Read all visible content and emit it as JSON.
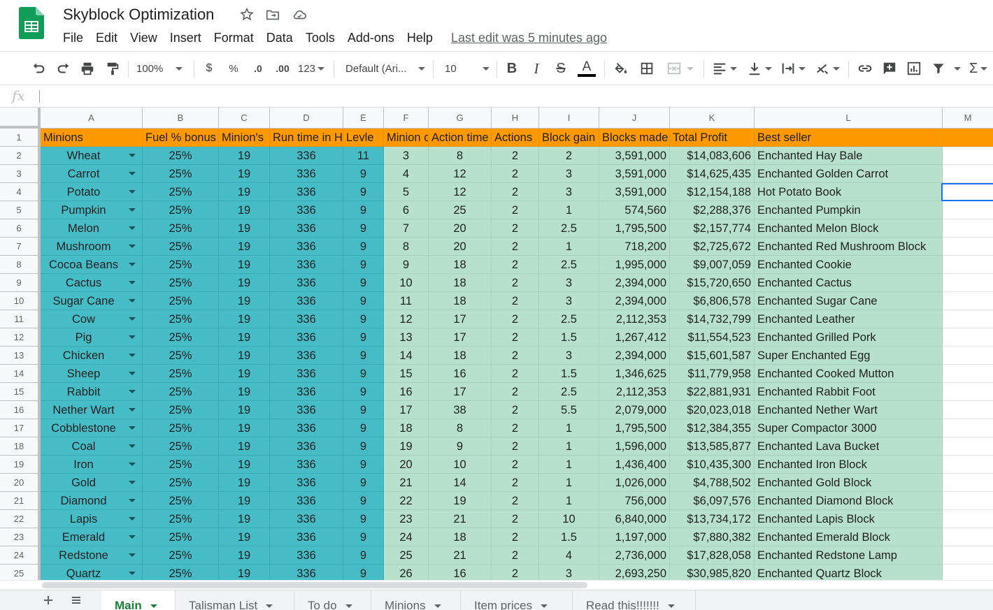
{
  "doc": {
    "title": "Skyblock Optimization",
    "last_edit": "Last edit was 5 minutes ago"
  },
  "menu": [
    "File",
    "Edit",
    "View",
    "Insert",
    "Format",
    "Data",
    "Tools",
    "Add-ons",
    "Help"
  ],
  "toolbar": {
    "zoom": "100%",
    "currency": "$",
    "percent": "%",
    "decrease_decimal": ".0",
    "increase_decimal": ".00",
    "more_formats": "123",
    "font": "Default (Ari...",
    "font_size": "10",
    "bold": "B",
    "italic": "I",
    "strikethrough": "S",
    "text_color": "A"
  },
  "formula_bar": {
    "icon": "fx",
    "value": ""
  },
  "colors": {
    "header_orange": "#ff9900",
    "teal": "#46bdc6",
    "mint": "#b7e1cd",
    "selection": "#1a73e8",
    "active_tab": "#188038"
  },
  "grid": {
    "columns": [
      "A",
      "B",
      "C",
      "D",
      "E",
      "F",
      "G",
      "H",
      "I",
      "J",
      "K",
      "L",
      "M"
    ],
    "header_row": [
      "Minions",
      "Fuel % bonus",
      "Minion's",
      "Run time in H",
      "Levle",
      "Minion c",
      "Action time",
      "Actions",
      "Block gain",
      "Blocks made",
      "Total Profit",
      "Best seller"
    ],
    "row_numbers": [
      "1",
      "2",
      "3",
      "4",
      "5",
      "6",
      "7",
      "8",
      "9",
      "10",
      "11",
      "12",
      "13",
      "14",
      "15",
      "16",
      "17",
      "18",
      "19",
      "20",
      "21",
      "22",
      "23",
      "24",
      "25"
    ],
    "selected_cell": "M4",
    "rows": [
      [
        "Wheat",
        "25%",
        "19",
        "336",
        "11",
        "3",
        "8",
        "2",
        "2",
        "3,591,000",
        "$14,083,606",
        "Enchanted Hay Bale"
      ],
      [
        "Carrot",
        "25%",
        "19",
        "336",
        "9",
        "4",
        "12",
        "2",
        "3",
        "3,591,000",
        "$14,625,435",
        "Enchanted Golden Carrot"
      ],
      [
        "Potato",
        "25%",
        "19",
        "336",
        "9",
        "5",
        "12",
        "2",
        "3",
        "3,591,000",
        "$12,154,188",
        "Hot Potato Book"
      ],
      [
        "Pumpkin",
        "25%",
        "19",
        "336",
        "9",
        "6",
        "25",
        "2",
        "1",
        "574,560",
        "$2,288,376",
        "Enchanted Pumpkin"
      ],
      [
        "Melon",
        "25%",
        "19",
        "336",
        "9",
        "7",
        "20",
        "2",
        "2.5",
        "1,795,500",
        "$2,157,774",
        "Enchanted Melon Block"
      ],
      [
        "Mushroom",
        "25%",
        "19",
        "336",
        "9",
        "8",
        "20",
        "2",
        "1",
        "718,200",
        "$2,725,672",
        "Enchanted Red Mushroom Block"
      ],
      [
        "Cocoa Beans",
        "25%",
        "19",
        "336",
        "9",
        "9",
        "18",
        "2",
        "2.5",
        "1,995,000",
        "$9,007,059",
        "Enchanted Cookie"
      ],
      [
        "Cactus",
        "25%",
        "19",
        "336",
        "9",
        "10",
        "18",
        "2",
        "3",
        "2,394,000",
        "$15,720,650",
        "Enchanted Cactus"
      ],
      [
        "Sugar Cane",
        "25%",
        "19",
        "336",
        "9",
        "11",
        "18",
        "2",
        "3",
        "2,394,000",
        "$6,806,578",
        "Enchanted Sugar Cane"
      ],
      [
        "Cow",
        "25%",
        "19",
        "336",
        "9",
        "12",
        "17",
        "2",
        "2.5",
        "2,112,353",
        "$14,732,799",
        "Enchanted Leather"
      ],
      [
        "Pig",
        "25%",
        "19",
        "336",
        "9",
        "13",
        "17",
        "2",
        "1.5",
        "1,267,412",
        "$11,554,523",
        "Enchanted Grilled Pork"
      ],
      [
        "Chicken",
        "25%",
        "19",
        "336",
        "9",
        "14",
        "18",
        "2",
        "3",
        "2,394,000",
        "$15,601,587",
        "Super Enchanted Egg"
      ],
      [
        "Sheep",
        "25%",
        "19",
        "336",
        "9",
        "15",
        "16",
        "2",
        "1.5",
        "1,346,625",
        "$11,779,958",
        "Enchanted Cooked Mutton"
      ],
      [
        "Rabbit",
        "25%",
        "19",
        "336",
        "9",
        "16",
        "17",
        "2",
        "2.5",
        "2,112,353",
        "$22,881,931",
        "Enchanted Rabbit Foot"
      ],
      [
        "Nether Wart",
        "25%",
        "19",
        "336",
        "9",
        "17",
        "38",
        "2",
        "5.5",
        "2,079,000",
        "$20,023,018",
        "Enchanted Nether Wart"
      ],
      [
        "Cobblestone",
        "25%",
        "19",
        "336",
        "9",
        "18",
        "8",
        "2",
        "1",
        "1,795,500",
        "$12,384,355",
        "Super Compactor 3000"
      ],
      [
        "Coal",
        "25%",
        "19",
        "336",
        "9",
        "19",
        "9",
        "2",
        "1",
        "1,596,000",
        "$13,585,877",
        "Enchanted Lava Bucket"
      ],
      [
        "Iron",
        "25%",
        "19",
        "336",
        "9",
        "20",
        "10",
        "2",
        "1",
        "1,436,400",
        "$10,435,300",
        "Enchanted Iron Block"
      ],
      [
        "Gold",
        "25%",
        "19",
        "336",
        "9",
        "21",
        "14",
        "2",
        "1",
        "1,026,000",
        "$4,788,502",
        "Enchanted Gold Block"
      ],
      [
        "Diamond",
        "25%",
        "19",
        "336",
        "9",
        "22",
        "19",
        "2",
        "1",
        "756,000",
        "$6,097,576",
        "Enchanted Diamond Block"
      ],
      [
        "Lapis",
        "25%",
        "19",
        "336",
        "9",
        "23",
        "21",
        "2",
        "10",
        "6,840,000",
        "$13,734,172",
        "Enchanted Lapis Block"
      ],
      [
        "Emerald",
        "25%",
        "19",
        "336",
        "9",
        "24",
        "18",
        "2",
        "1.5",
        "1,197,000",
        "$7,880,382",
        "Enchanted Emerald Block"
      ],
      [
        "Redstone",
        "25%",
        "19",
        "336",
        "9",
        "25",
        "21",
        "2",
        "4",
        "2,736,000",
        "$17,828,058",
        "Enchanted Redstone Lamp"
      ],
      [
        "Quartz",
        "25%",
        "19",
        "336",
        "9",
        "26",
        "16",
        "2",
        "3",
        "2,693,250",
        "$30,985,820",
        "Enchanted Quartz Block"
      ]
    ]
  },
  "sheet_tabs": [
    {
      "label": "Main",
      "active": true
    },
    {
      "label": "Talisman List",
      "active": false
    },
    {
      "label": "To do",
      "active": false
    },
    {
      "label": "Minions",
      "active": false
    },
    {
      "label": "Item prices",
      "active": false
    },
    {
      "label": "Read this!!!!!!!",
      "active": false
    }
  ],
  "icons": [
    "sheets-logo-icon",
    "star-icon",
    "move-to-folder-icon",
    "cloud-status-icon",
    "undo-icon",
    "redo-icon",
    "print-icon",
    "paint-format-icon",
    "borders-icon",
    "merge-cells-icon",
    "fill-color-icon",
    "align-left-icon",
    "valign-bottom-icon",
    "text-wrap-icon",
    "text-rotate-icon",
    "link-icon",
    "insert-comment-icon",
    "insert-chart-icon",
    "filter-icon",
    "functions-icon",
    "add-sheet-icon",
    "all-sheets-icon"
  ]
}
